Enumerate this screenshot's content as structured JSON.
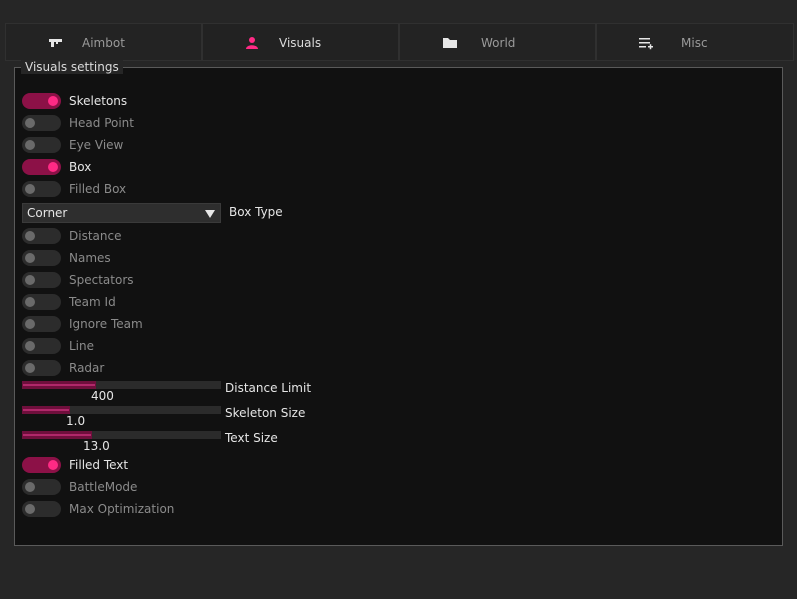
{
  "tabs": [
    {
      "label": "Aimbot",
      "icon": "gun-icon",
      "active": false
    },
    {
      "label": "Visuals",
      "icon": "user-icon",
      "active": true
    },
    {
      "label": "World",
      "icon": "folder-icon",
      "active": false
    },
    {
      "label": "Misc",
      "icon": "list-settings-icon",
      "active": false
    }
  ],
  "panel": {
    "title": "Visuals settings"
  },
  "toggles": {
    "skeletons": {
      "label": "Skeletons",
      "on": true
    },
    "head_point": {
      "label": "Head Point",
      "on": false
    },
    "eye_view": {
      "label": "Eye View",
      "on": false
    },
    "box": {
      "label": "Box",
      "on": true
    },
    "filled_box": {
      "label": "Filled Box",
      "on": false
    },
    "distance": {
      "label": "Distance",
      "on": false
    },
    "names": {
      "label": "Names",
      "on": false
    },
    "spectators": {
      "label": "Spectators",
      "on": false
    },
    "team_id": {
      "label": "Team Id",
      "on": false
    },
    "ignore_team": {
      "label": "Ignore Team",
      "on": false
    },
    "line": {
      "label": "Line",
      "on": false
    },
    "radar": {
      "label": "Radar",
      "on": false
    },
    "filled_text": {
      "label": "Filled Text",
      "on": true
    },
    "battle_mode": {
      "label": "BattleMode",
      "on": false
    },
    "max_optimization": {
      "label": "Max Optimization",
      "on": false
    }
  },
  "box_type": {
    "value": "Corner",
    "label": "Box Type"
  },
  "sliders": {
    "distance_limit": {
      "label": "Distance Limit",
      "value": "400",
      "fraction": 0.37
    },
    "skeleton_size": {
      "label": "Skeleton Size",
      "value": "1.0",
      "fraction": 0.24
    },
    "text_size": {
      "label": "Text Size",
      "value": "13.0",
      "fraction": 0.35
    }
  },
  "colors": {
    "accent": "#ff2a85",
    "accent_dark": "#8c1147",
    "panel_bg": "#111111",
    "window_bg": "#262626"
  }
}
